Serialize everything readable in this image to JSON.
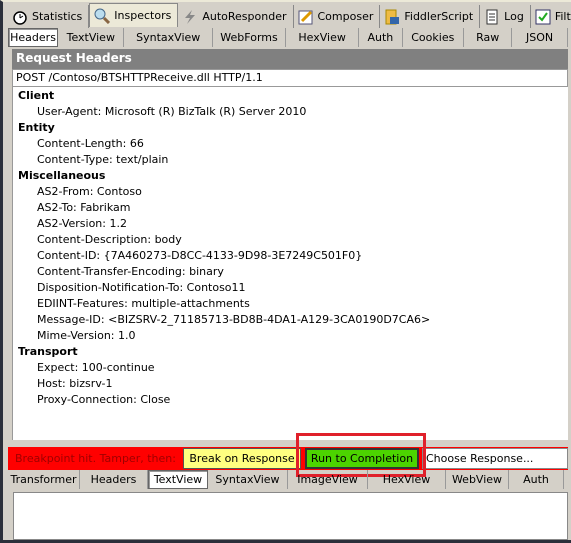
{
  "top_tabs": [
    {
      "label": "Statistics",
      "icon": "stopwatch-icon"
    },
    {
      "label": "Inspectors",
      "icon": "magnifier-icon",
      "active": true
    },
    {
      "label": "AutoResponder",
      "icon": "lightning-icon"
    },
    {
      "label": "Composer",
      "icon": "pencil-icon"
    },
    {
      "label": "FiddlerScript",
      "icon": "script-icon"
    },
    {
      "label": "Log",
      "icon": "log-icon"
    },
    {
      "label": "Filters",
      "icon": "checkbox-icon"
    }
  ],
  "request_tabs": [
    "Headers",
    "TextView",
    "SyntaxView",
    "WebForms",
    "HexView",
    "Auth",
    "Cookies",
    "Raw",
    "JSON"
  ],
  "request_active_tab": "Headers",
  "headers_title": "Request Headers",
  "request_line": "POST /Contoso/BTSHTTPReceive.dll HTTP/1.1",
  "sections": [
    {
      "name": "Client",
      "items": [
        "User-Agent: Microsoft (R) BizTalk (R) Server 2010"
      ]
    },
    {
      "name": "Entity",
      "items": [
        "Content-Length: 66",
        "Content-Type: text/plain"
      ]
    },
    {
      "name": "Miscellaneous",
      "items": [
        "AS2-From: Contoso",
        "AS2-To: Fabrikam",
        "AS2-Version: 1.2",
        "Content-Description: body",
        "Content-ID: {7A460273-D8CC-4133-9D98-3E7249C501F0}",
        "Content-Transfer-Encoding: binary",
        "Disposition-Notification-To: Contoso11",
        "EDIINT-Features: multiple-attachments",
        "Message-ID: <BIZSRV-2_71185713-BD8B-4DA1-A129-3CA0190D7CA6>",
        "Mime-Version: 1.0"
      ]
    },
    {
      "name": "Transport",
      "items": [
        "Expect: 100-continue",
        "Host: bizsrv-1",
        "Proxy-Connection: Close"
      ]
    }
  ],
  "breakpoint": {
    "text": "Breakpoint hit. Tamper, then:",
    "break_on_response": "Break on Response",
    "run_to_completion": "Run to Completion",
    "choose_response": "Choose Response...",
    "bar_color": "#ff0000",
    "break_color": "#ffff80",
    "run_color": "#4cd400",
    "highlight_color": "#e0202a"
  },
  "response_tabs": [
    "Transformer",
    "Headers",
    "TextView",
    "SyntaxView",
    "ImageView",
    "HexView",
    "WebView",
    "Auth",
    "Ca"
  ],
  "response_active_tab": "TextView"
}
